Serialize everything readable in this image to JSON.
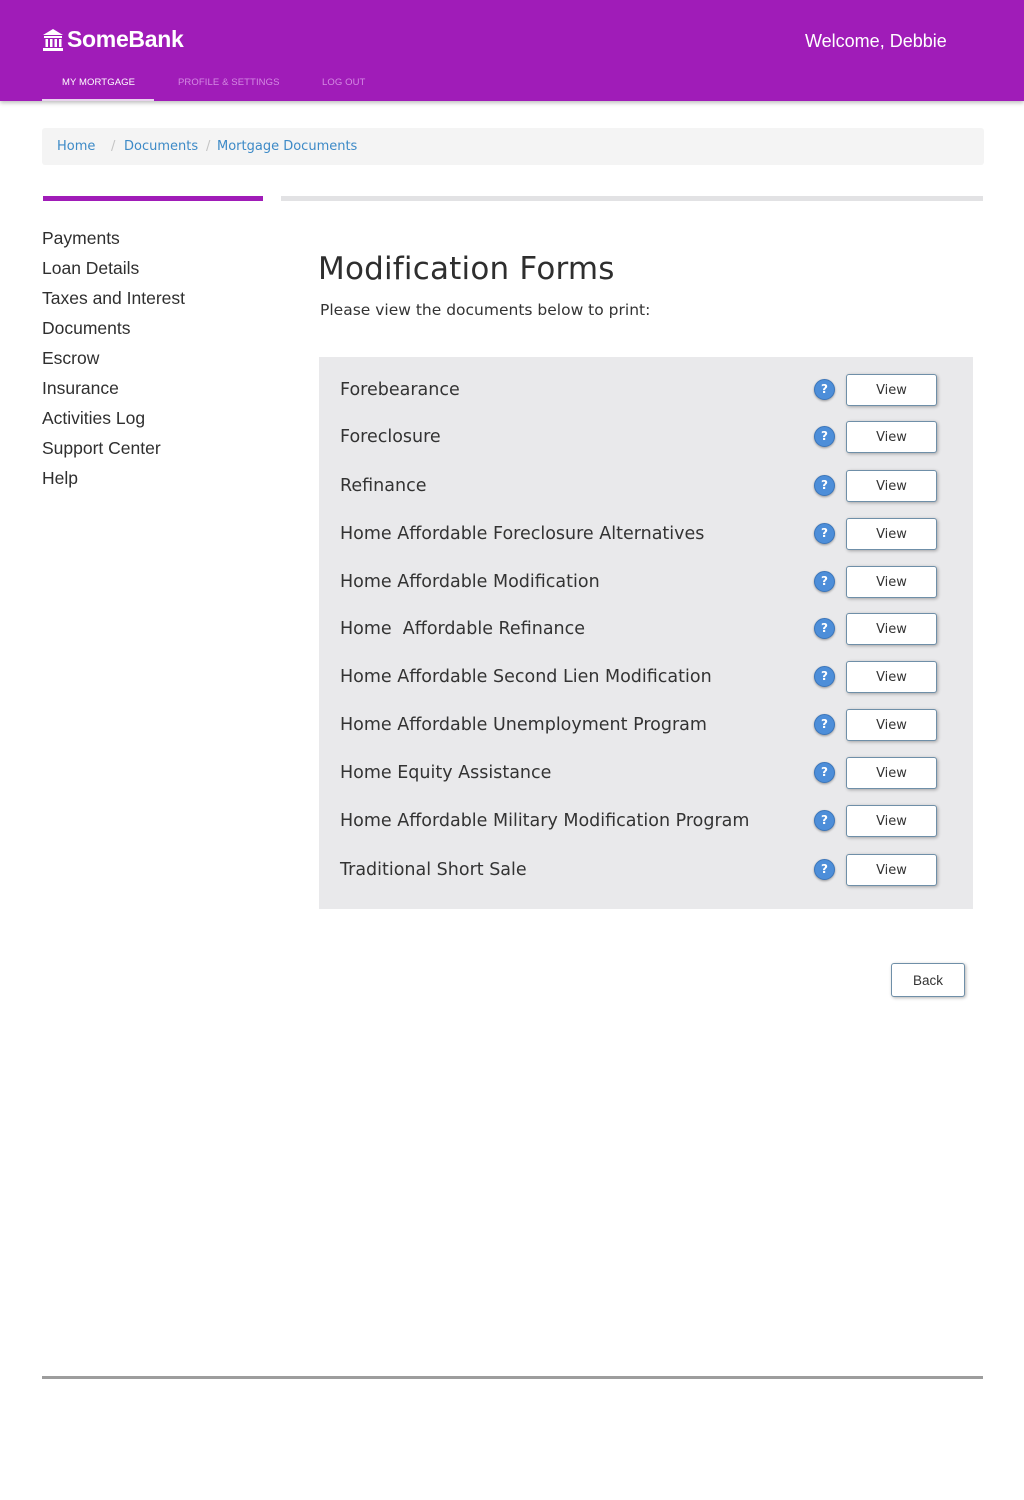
{
  "header": {
    "brand_name": "SomeBank",
    "brand_icon": "bank-building-icon",
    "welcome": "Welcome, Debbie",
    "nav": [
      {
        "label": "MY MORTGAGE",
        "active": true
      },
      {
        "label": "PROFILE & SETTINGS",
        "active": false
      },
      {
        "label": "LOG OUT",
        "active": false
      }
    ]
  },
  "breadcrumb": {
    "items": [
      "Home",
      "Documents",
      "Mortgage Documents"
    ],
    "separator": "/"
  },
  "sidebar": {
    "items": [
      "Payments",
      "Loan Details",
      "Taxes and Interest",
      "Documents",
      "Escrow",
      "Insurance",
      "Activities Log",
      "Support Center",
      "Help"
    ]
  },
  "main": {
    "title": "Modification Forms",
    "subtitle": "Please view the documents below to print:",
    "documents": [
      {
        "label": "Forebearance",
        "help": "?",
        "action": "View"
      },
      {
        "label": "Foreclosure",
        "help": "?",
        "action": "View"
      },
      {
        "label": "Refinance",
        "help": "?",
        "action": "View"
      },
      {
        "label": "Home Affordable Foreclosure Alternatives",
        "help": "?",
        "action": "View"
      },
      {
        "label": "Home Affordable Modification",
        "help": "?",
        "action": "View"
      },
      {
        "label": "Home  Affordable Refinance",
        "help": "?",
        "action": "View"
      },
      {
        "label": "Home Affordable Second Lien Modification",
        "help": "?",
        "action": "View"
      },
      {
        "label": "Home Affordable Unemployment Program",
        "help": "?",
        "action": "View"
      },
      {
        "label": "Home Equity Assistance",
        "help": "?",
        "action": "View"
      },
      {
        "label": "Home Affordable Military Modification Program",
        "help": "?",
        "action": "View"
      },
      {
        "label": "Traditional Short Sale",
        "help": "?",
        "action": "View"
      }
    ],
    "back_label": "Back"
  },
  "colors": {
    "brand": "#a01cb8",
    "link": "#3d8ac7",
    "help_icon": "#4d8ed9",
    "panel": "#e9e9eb"
  }
}
